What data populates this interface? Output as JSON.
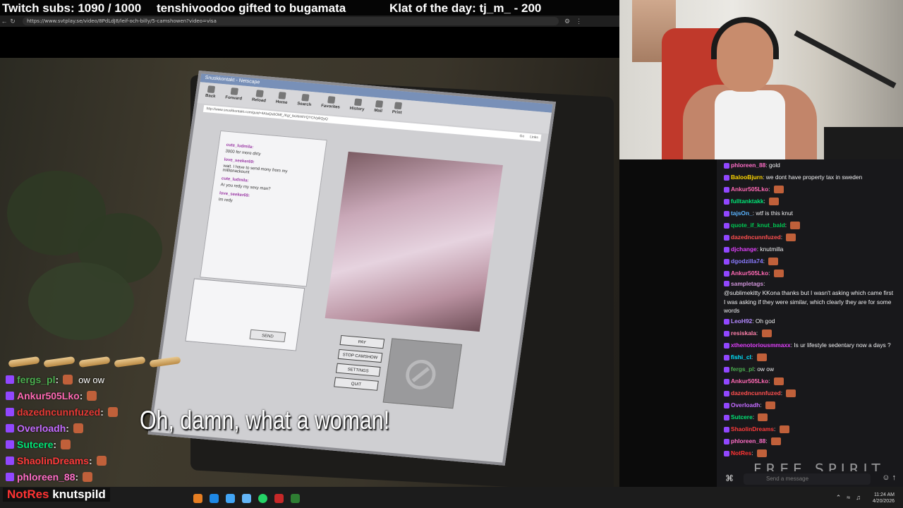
{
  "overlay": {
    "subs_text": "Twitch subs: 1090 / 1000",
    "gift_text": "tenshivoodoo gifted to bugamata",
    "klat_text": "Klat of the day: tj_m_ - 200"
  },
  "browser": {
    "url": "https://www.svtplay.se/video/8PdLdJ8/leif-och-billy/5-camshowen?video=visa"
  },
  "video": {
    "subtitle": "Oh, damn, what a woman!",
    "cam_window": {
      "title": "Snuskkontakt - Netscape",
      "toolbar": [
        "Back",
        "Forward",
        "Reload",
        "Home",
        "Search",
        "Favorites",
        "History",
        "Mail",
        "Print"
      ],
      "address": "http://www.snuskkontakt.com/guid=4AIaQubOMf_/Kg/_fe/AhWVQYCh/yBQyQ",
      "go_label": "Go",
      "links_label": "Links",
      "chat": [
        {
          "user": "cute_ludmila:",
          "text": "3000 for more dirty"
        },
        {
          "user": "love_seeker69:",
          "text": "wait. I have to send mony from my millionackount"
        },
        {
          "user": "cute_ludmila:",
          "text": "Ar you redy my sexy man?"
        },
        {
          "user": "love_seeker69:",
          "text": "Im redy"
        }
      ],
      "send_label": "SEND",
      "buttons": [
        "PAY",
        "STOP CAMSHOW",
        "SETTINGS",
        "QUIT"
      ]
    }
  },
  "overlay_chat": [
    {
      "user": "fergs_pl",
      "color": "#4caf50",
      "msg": "ow ow"
    },
    {
      "user": "Ankur505Lko",
      "color": "#ff69b4",
      "msg": ""
    },
    {
      "user": "dazedncunnfuzed",
      "color": "#e53935",
      "msg": ""
    },
    {
      "user": "Overloadh",
      "color": "#c36bff",
      "msg": ""
    },
    {
      "user": "Sutcere",
      "color": "#00e676",
      "msg": ""
    },
    {
      "user": "ShaolinDreams",
      "color": "#ff3b3b",
      "msg": ""
    },
    {
      "user": "phloreen_88",
      "color": "#ff6ec7",
      "msg": ""
    }
  ],
  "bottom_name": {
    "prefix": "NotRes",
    "suffix": "knutspild"
  },
  "twitch_chat": [
    {
      "user": "phloreen_88",
      "color": "#ff6ec7",
      "text": "gold"
    },
    {
      "user": "BalooBjurn",
      "color": "#ffd700",
      "text": "we dont have property tax in sweden"
    },
    {
      "user": "Ankur505Lko",
      "color": "#ff69b4",
      "text": ""
    },
    {
      "user": "fulltanktakk",
      "color": "#00e676",
      "text": ""
    },
    {
      "user": "tajsOn_",
      "color": "#5ab4ff",
      "text": "wtf is this knut"
    },
    {
      "user": "quote_if_knut_bald",
      "color": "#00c853",
      "text": ""
    },
    {
      "user": "dazedncunnfuzed",
      "color": "#ff4f4f",
      "text": ""
    },
    {
      "user": "djchange",
      "color": "#e040fb",
      "text": "knutmilla"
    },
    {
      "user": "dgodzilla74",
      "color": "#8a7bff",
      "text": ""
    },
    {
      "user": "Ankur505Lko",
      "color": "#ff69b4",
      "text": ""
    },
    {
      "user": "sampletags",
      "color": "#ce93d8",
      "text": "@sublimekitty KKona thanks but I wasn't asking which came first I was asking if they were similar, which clearly they are for some words"
    },
    {
      "user": "LeoH92",
      "color": "#b388ff",
      "text": "Oh god"
    },
    {
      "user": "resiskala",
      "color": "#ff80ab",
      "text": ""
    },
    {
      "user": "xthenotoriousmmaxx",
      "color": "#e040fb",
      "text": "Is ur lifestyle sedentary now a days ?"
    },
    {
      "user": "fishi_cl",
      "color": "#00e5ff",
      "text": ""
    },
    {
      "user": "fergs_pl",
      "color": "#4caf50",
      "text": "ow ow"
    },
    {
      "user": "Ankur505Lko",
      "color": "#ff69b4",
      "text": ""
    },
    {
      "user": "dazedncunnfuzed",
      "color": "#ff4f4f",
      "text": ""
    },
    {
      "user": "Overloadh",
      "color": "#c36bff",
      "text": ""
    },
    {
      "user": "Sutcere",
      "color": "#00e676",
      "text": ""
    },
    {
      "user": "ShaolinDreams",
      "color": "#ff3b3b",
      "text": ""
    },
    {
      "user": "phloreen_88",
      "color": "#ff6ec7",
      "text": ""
    },
    {
      "user": "NotRes",
      "color": "#ff3333",
      "text": ""
    }
  ],
  "chat_input": {
    "placeholder": "Send a message"
  },
  "watermark": "FREE SPIRIT",
  "clock": {
    "time": "11:24 AM",
    "date": "4/20/2026"
  }
}
